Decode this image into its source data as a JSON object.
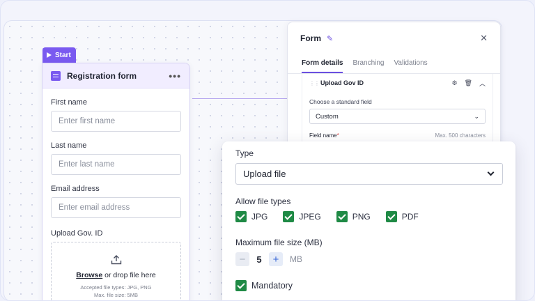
{
  "start_tag": {
    "label": "Start"
  },
  "registration_card": {
    "title": "Registration form",
    "more_label": "•••",
    "fields": [
      {
        "label": "First name",
        "placeholder": "Enter first name"
      },
      {
        "label": "Last name",
        "placeholder": "Enter last name"
      },
      {
        "label": "Email address",
        "placeholder": "Enter email address"
      }
    ],
    "upload": {
      "label": "Upload Gov. ID",
      "browse_link": "Browse",
      "drop_text": " or drop file here",
      "hint_line1": "Accepted file types: JPG, PNG",
      "hint_line2": "Max. file size: 5MB"
    }
  },
  "side_panel": {
    "title": "Form",
    "tabs": [
      {
        "label": "Form details",
        "active": true
      },
      {
        "label": "Branching",
        "active": false
      },
      {
        "label": "Validations",
        "active": false
      }
    ],
    "section_title": "Upload Gov ID",
    "standard_field_label": "Choose a standard field",
    "standard_field_value": "Custom",
    "field_name_label": "Field name",
    "field_name_required": "*",
    "field_name_max": "Max. 500 characters"
  },
  "front_card": {
    "type_label": "Type",
    "type_value": "Upload file",
    "file_types_label": "Allow file types",
    "file_types": [
      {
        "label": "JPG",
        "checked": true
      },
      {
        "label": "JPEG",
        "checked": true
      },
      {
        "label": "PNG",
        "checked": true
      },
      {
        "label": "PDF",
        "checked": true
      }
    ],
    "max_size_label": "Maximum file size (MB)",
    "max_size_value": "5",
    "max_size_unit": "MB",
    "mandatory_label": "Mandatory",
    "mandatory_checked": true
  },
  "colors": {
    "accent": "#7a5af0",
    "check_green": "#1f8a45",
    "required_red": "#d93a3a"
  }
}
